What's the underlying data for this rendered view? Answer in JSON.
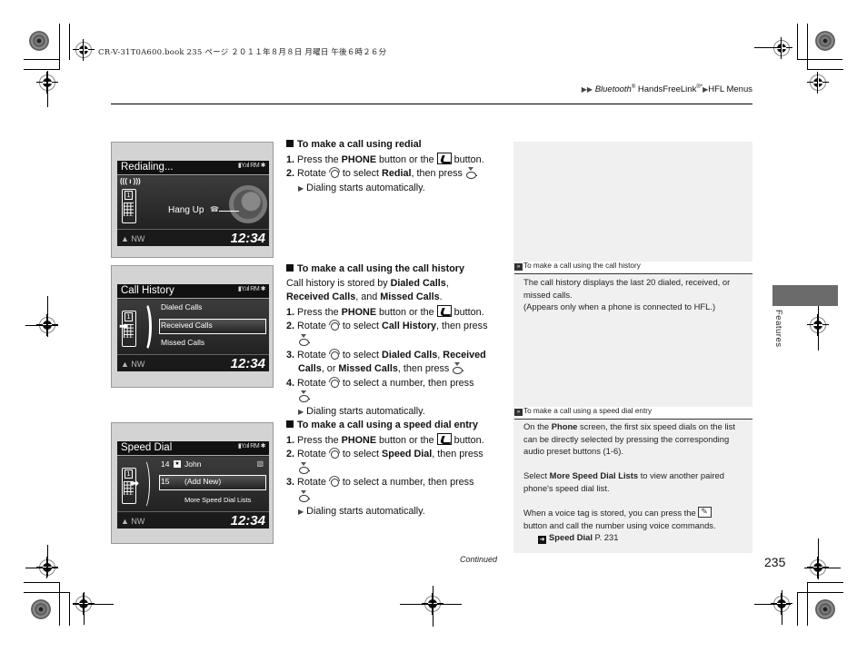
{
  "print_header": "CR-V-31T0A600.book  235 ページ  ２０１１年８月８日  月曜日  午後６時２６分",
  "breadcrumb": {
    "prefix_icon": "double-triangle-right-icon",
    "part1": "Bluetooth",
    "part1_sup": "®",
    "part2": " HandsFreeLink",
    "part2_sup": "®*",
    "separator_icon": "triangle-right-icon",
    "part3": "HFL Menus"
  },
  "screens": {
    "redial": {
      "title": "Redialing...",
      "status": "▮Y.ııl RM ✱",
      "signal": "((( ı )))",
      "phone_number": "1",
      "hang_up": "Hang Up",
      "compass": "▲ NW",
      "clock": "12:34"
    },
    "history": {
      "title": "Call History",
      "status": "▮Y.ııl RM ✱",
      "phone_number": "1",
      "items": [
        "Dialed Calls",
        "Received Calls",
        "Missed Calls"
      ],
      "selected_index": 1,
      "compass": "▲ NW",
      "clock": "12:34"
    },
    "speed": {
      "title": "Speed Dial",
      "status": "▮Y.ııl RM ✱",
      "phone_number": "1",
      "entry1_num": "14",
      "entry1_name": "John",
      "entry2_num": "15",
      "entry2_name": "(Add New)",
      "more": "More Speed Dial Lists",
      "compass": "▲ NW",
      "clock": "12:34"
    }
  },
  "sections": {
    "redial": {
      "heading": "To make a call using redial",
      "s1_num": "1.",
      "s1_a": " Press the ",
      "s1_b": "PHONE",
      "s1_c": " button or the ",
      "s1_d": " button.",
      "s2_num": "2.",
      "s2_a": " Rotate ",
      "s2_b": " to select ",
      "s2_c": "Redial",
      "s2_d": ", then press ",
      "s2_e": ".",
      "result": " Dialing starts automatically."
    },
    "history": {
      "heading": "To make a call using the call history",
      "intro_a": "Call history is stored by ",
      "intro_b": "Dialed Calls",
      "intro_c": ",",
      "intro_d": "Received Calls",
      "intro_e": ", and ",
      "intro_f": "Missed Calls",
      "intro_g": ".",
      "s1_num": "1.",
      "s1_a": " Press the ",
      "s1_b": "PHONE",
      "s1_c": " button or the ",
      "s1_d": " button.",
      "s2_num": "2.",
      "s2_a": " Rotate ",
      "s2_b": " to select ",
      "s2_c": "Call History",
      "s2_d": ", then press",
      "s2_e": ".",
      "s3_num": "3.",
      "s3_a": " Rotate ",
      "s3_b": " to select ",
      "s3_c": "Dialed Calls",
      "s3_d": ", ",
      "s3_e": "Received Calls",
      "s3_f": ", or ",
      "s3_g": "Missed Calls",
      "s3_h": ", then press ",
      "s3_i": ".",
      "s4_num": "4.",
      "s4_a": " Rotate ",
      "s4_b": " to select a number, then press",
      "s4_c": ".",
      "result": " Dialing starts automatically."
    },
    "speed": {
      "heading": "To make a call using a speed dial entry",
      "s1_num": "1.",
      "s1_a": " Press the ",
      "s1_b": "PHONE",
      "s1_c": " button or the ",
      "s1_d": " button.",
      "s2_num": "2.",
      "s2_a": " Rotate ",
      "s2_b": " to select ",
      "s2_c": "Speed Dial",
      "s2_d": ", then press",
      "s2_e": ".",
      "s3_num": "3.",
      "s3_a": " Rotate ",
      "s3_b": " to select a number, then press",
      "s3_c": ".",
      "result": " Dialing starts automatically."
    }
  },
  "notes": {
    "history": {
      "heading": "To make a call using the call history",
      "p1": "The call history displays the last 20 dialed, received, or missed calls.",
      "p2": "(Appears only when a phone is connected to HFL.)"
    },
    "speed": {
      "heading": "To make a call using a speed dial entry",
      "p1_a": "On the ",
      "p1_b": "Phone",
      "p1_c": " screen, the first six speed dials on the list can be directly selected by pressing the corresponding audio preset buttons (1-6).",
      "p2_a": "Select ",
      "p2_b": "More Speed Dial Lists",
      "p2_c": " to view another paired phone's speed dial list.",
      "p3_a": "When a voice tag is stored, you can press the ",
      "p3_b": " button and call the number using voice commands.",
      "xref_label": "Speed Dial",
      "xref_page": " P. 231"
    }
  },
  "side_tab": "Features",
  "footer": {
    "continued": "Continued",
    "page_number": "235"
  }
}
